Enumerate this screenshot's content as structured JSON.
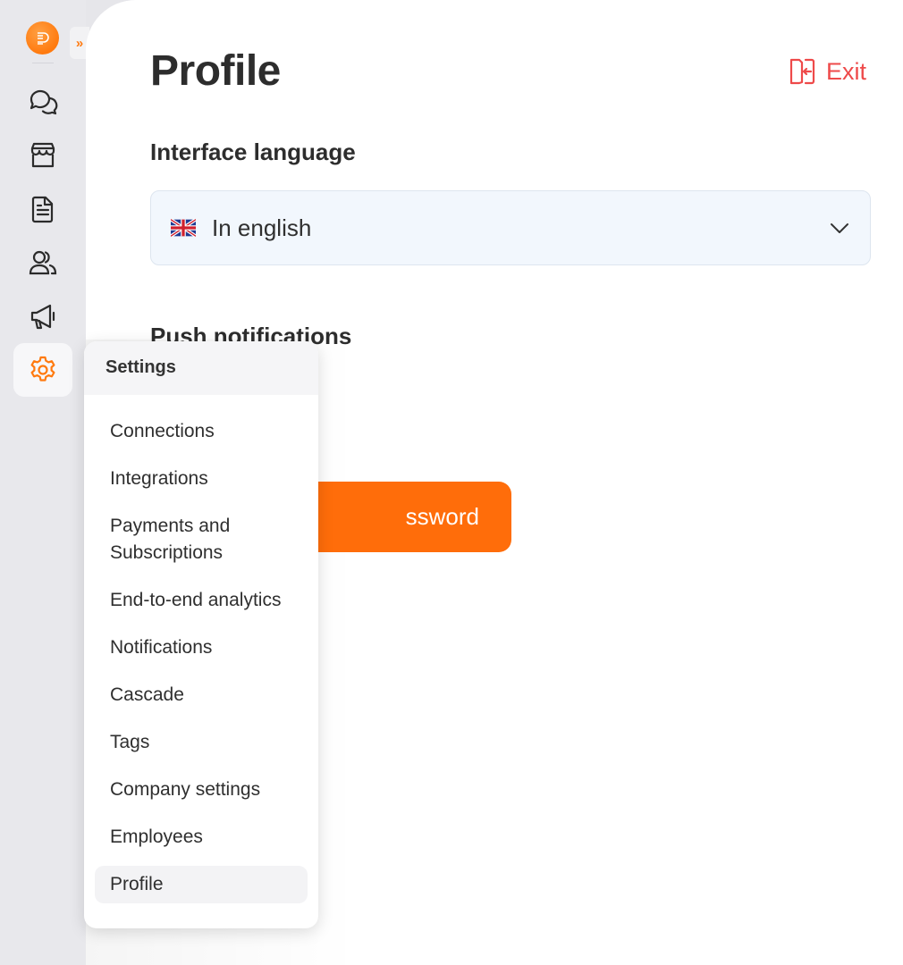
{
  "sidebar": {
    "expand_glyph": "»",
    "items": [
      {
        "name": "chats-icon"
      },
      {
        "name": "store-icon"
      },
      {
        "name": "document-icon"
      },
      {
        "name": "users-icon"
      },
      {
        "name": "megaphone-icon"
      },
      {
        "name": "gear-icon",
        "active": true
      }
    ],
    "accent_color": "#ff7a0f"
  },
  "page": {
    "title": "Profile",
    "exit_label": "Exit",
    "exit_color": "#ee4a4a"
  },
  "language": {
    "section_label": "Interface language",
    "selected": "In english",
    "flag": "uk-flag-icon"
  },
  "push": {
    "section_label": "Push notifications"
  },
  "password_button": {
    "visible_label": "ssword",
    "color": "#ff6d0a"
  },
  "settings_menu": {
    "header": "Settings",
    "items": [
      "Connections",
      "Integrations",
      "Payments and Subscriptions",
      "End-to-end analytics",
      "Notifications",
      "Cascade",
      "Tags",
      "Company settings",
      "Employees",
      "Profile"
    ],
    "selected": "Profile"
  }
}
